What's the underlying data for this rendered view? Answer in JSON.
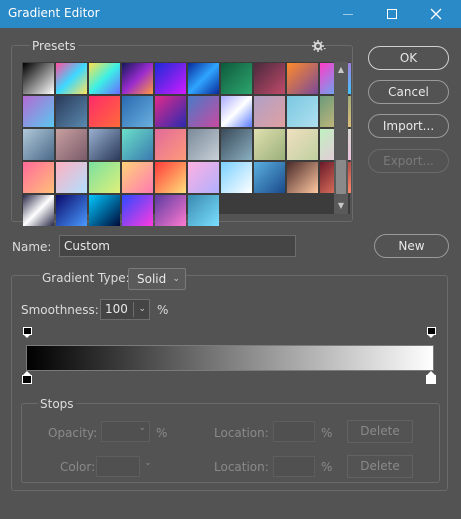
{
  "window": {
    "title": "Gradient Editor"
  },
  "presets": {
    "label": "Presets",
    "gear_icon": "gear-icon",
    "swatches": [
      "linear-gradient(135deg,#000 0%,#fff 100%)",
      "linear-gradient(135deg,#ff4fa0 0%,#3cd9ff 50%,#ffe35a 100%)",
      "linear-gradient(135deg,#ffe24c 0%,#3cf0e6 50%,#6b6bff 100%)",
      "linear-gradient(135deg,#141a5a 0%,#9a2bcf 50%,#ff9a3c 100%)",
      "linear-gradient(135deg,#1b2ad8 0%,#d01cff 100%)",
      "linear-gradient(135deg,#0a2a9a 0%,#2fa5ff 50%,#0a2a9a 100%)",
      "linear-gradient(135deg,#0d5a3c 0%,#2ea66e 100%)",
      "linear-gradient(135deg,#4a2a3c 0%,#c04a6a 100%)",
      "linear-gradient(135deg,#ff8a2a 0%,#7a4a9a 100%)",
      "linear-gradient(135deg,#ff3cc8 0%,#3cc8ff 100%)",
      "linear-gradient(135deg,#b46ad2 0%,#5ac8f0 100%)",
      "linear-gradient(135deg,#2a3a5a 0%,#5a8ab0 100%)",
      "linear-gradient(135deg,#ff2a6a 0%,#ff6a3a 100%)",
      "linear-gradient(135deg,#2a6ab0 0%,#6ab0e0 100%)",
      "linear-gradient(135deg,#e02a8a 0%,#2a2ab0 100%)",
      "linear-gradient(135deg,#4a7ac8 0%,#c84aa0 100%)",
      "linear-gradient(135deg,#aaaaff 0%,#ffffff 50%,#5a7aff 100%)",
      "linear-gradient(135deg,#b0a0c8 0%,#e0a0a0 100%)",
      "linear-gradient(135deg,#7ac8e0 0%,#b0e0f0 100%)",
      "linear-gradient(135deg,#6a9a7a 0%,#e0c07a 100%)",
      "linear-gradient(135deg,#b0c8d8 0%,#4a6a8a 100%)",
      "linear-gradient(135deg,#c8a0a0 0%,#7a5a6a 100%)",
      "linear-gradient(135deg,#9ab0d0 0%,#2a3a5a 100%)",
      "linear-gradient(135deg,#6ae0c8 0%,#3a7ab0 100%)",
      "linear-gradient(135deg,#e06a9a 0%,#ff9a7a 100%)",
      "linear-gradient(135deg,#7a8a9a 0%,#c8d0d8 100%)",
      "linear-gradient(135deg,#3a4a5a 0%,#8ab0c0 100%)",
      "linear-gradient(135deg,#e0e0b0 0%,#9ab07a 100%)",
      "linear-gradient(135deg,#f0e0c0 0%,#c0d0a0 100%)",
      "linear-gradient(135deg,#c0f0c0 0%,#f0c0e0 100%)",
      "linear-gradient(135deg,#ff6a9a 0%,#ffc07a 100%)",
      "linear-gradient(135deg,#ffb0c0 0%,#b0e0ff 100%)",
      "linear-gradient(135deg,#7ae0a0 0%,#e0f07a 100%)",
      "linear-gradient(135deg,#ffd27a 0%,#ff7ab0 100%)",
      "linear-gradient(135deg,#ff3a3a 0%,#ffe07a 100%)",
      "linear-gradient(135deg,#ffb0e0 0%,#b0b0ff 100%)",
      "linear-gradient(135deg,#7ad0ff 0%,#ffffff 100%)",
      "linear-gradient(135deg,#5ab0e0 0%,#1a4a8a 100%)",
      "linear-gradient(135deg,#4a2a2a 0%,#ffc8a0 100%)",
      "linear-gradient(135deg,#6a1a2a 0%,#ff8a6a 100%)",
      "linear-gradient(135deg,#2a2a4a 0%,#ffffff 50%,#2a2a4a 100%)",
      "linear-gradient(135deg,#0a0a6a 0%,#4a9aff 100%)",
      "linear-gradient(135deg,#00c8ff 0%,#000a3a 100%)",
      "linear-gradient(135deg,#2a4aff 0%,#ff3ae0 100%)",
      "linear-gradient(135deg,#5a3aa0 0%,#ff7ad0 100%)",
      "linear-gradient(135deg,#3a8ab0 0%,#7ae0ff 100%)"
    ]
  },
  "buttons": {
    "ok": "OK",
    "cancel": "Cancel",
    "import": "Import...",
    "export": "Export...",
    "new": "New"
  },
  "name": {
    "label": "Name:",
    "value": "Custom"
  },
  "gradient_type": {
    "label": "Gradient Type:",
    "value": "Solid"
  },
  "smoothness": {
    "label": "Smoothness:",
    "value": "100",
    "unit": "%"
  },
  "gradient": {
    "css": "linear-gradient(to right,#000000 0%,#ffffff 100%)",
    "opacity_stops": [
      0,
      100
    ],
    "color_stops": [
      {
        "location": 0,
        "color": "#000000"
      },
      {
        "location": 100,
        "color": "#ffffff"
      }
    ]
  },
  "stops": {
    "label": "Stops",
    "opacity_label": "Opacity:",
    "opacity_unit": "%",
    "opacity_location_label": "Location:",
    "opacity_location_unit": "%",
    "opacity_delete": "Delete",
    "color_label": "Color:",
    "color_location_label": "Location:",
    "color_location_unit": "%",
    "color_delete": "Delete"
  }
}
